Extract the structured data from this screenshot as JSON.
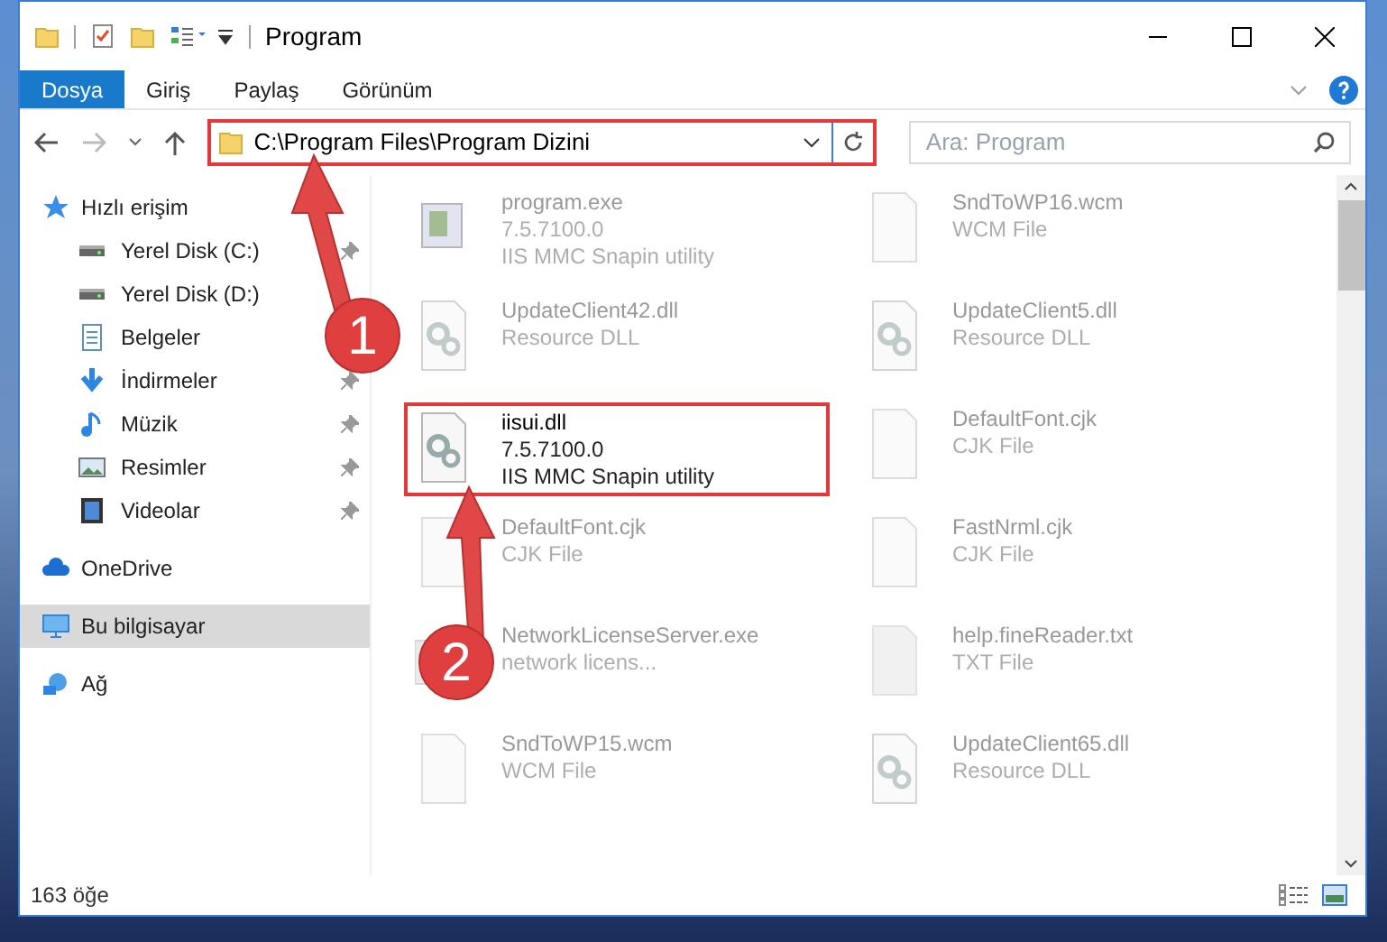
{
  "window": {
    "title": "Program"
  },
  "ribbon_tabs": [
    {
      "label": "Dosya",
      "selected": true
    },
    {
      "label": "Giriş",
      "selected": false
    },
    {
      "label": "Paylaş",
      "selected": false
    },
    {
      "label": "Görünüm",
      "selected": false
    }
  ],
  "address_bar": {
    "path": "C:\\Program Files\\Program Dizini"
  },
  "search": {
    "placeholder": "Ara: Program"
  },
  "nav_pane": [
    {
      "label": "Hızlı erişim",
      "kind": "star",
      "selected": false,
      "children": [
        {
          "label": "Yerel Disk (C:)",
          "kind": "disk",
          "pinned": true
        },
        {
          "label": "Yerel Disk (D:)",
          "kind": "disk"
        },
        {
          "label": "Belgeler",
          "kind": "doc"
        },
        {
          "label": "İndirmeler",
          "kind": "download",
          "pinned": true
        },
        {
          "label": "Müzik",
          "kind": "music",
          "pinned": true
        },
        {
          "label": "Resimler",
          "kind": "picture",
          "pinned": true
        },
        {
          "label": "Videolar",
          "kind": "video",
          "pinned": true
        }
      ]
    },
    {
      "label": "OneDrive",
      "kind": "cloud",
      "selected": false
    },
    {
      "label": "Bu bilgisayar",
      "kind": "computer",
      "selected": true
    },
    {
      "label": "Ağ",
      "kind": "network",
      "selected": false
    }
  ],
  "files": [
    {
      "name": "program.exe",
      "lines": [
        "7.5.7100.0",
        "IIS MMC Snapin utility"
      ],
      "kind": "exe",
      "highlighted": false
    },
    {
      "name": "SndToWP16.wcm",
      "lines": [
        "WCM File"
      ],
      "kind": "blank",
      "highlighted": false
    },
    {
      "name": "UpdateClient42.dll",
      "lines": [
        "Resource DLL"
      ],
      "kind": "dll",
      "highlighted": false
    },
    {
      "name": "UpdateClient5.dll",
      "lines": [
        "Resource DLL"
      ],
      "kind": "dll",
      "highlighted": false
    },
    {
      "name": "iisui.dll",
      "lines": [
        "7.5.7100.0",
        "IIS MMC Snapin utility"
      ],
      "kind": "dll",
      "highlighted": true
    },
    {
      "name": "DefaultFont.cjk",
      "lines": [
        "CJK File"
      ],
      "kind": "blank",
      "highlighted": false
    },
    {
      "name": "DefaultFont.cjk",
      "lines": [
        "CJK File"
      ],
      "kind": "blank",
      "highlighted": false
    },
    {
      "name": "FastNrml.cjk",
      "lines": [
        "CJK File"
      ],
      "kind": "blank",
      "highlighted": false
    },
    {
      "name": "NetworkLicenseServer.exe",
      "lines": [
        "network licens..."
      ],
      "kind": "app",
      "highlighted": false
    },
    {
      "name": "help.fineReader.txt",
      "lines": [
        "TXT File"
      ],
      "kind": "txt",
      "highlighted": false
    },
    {
      "name": "SndToWP15.wcm",
      "lines": [
        "WCM File"
      ],
      "kind": "blank",
      "highlighted": false
    },
    {
      "name": "UpdateClient65.dll",
      "lines": [
        "Resource DLL"
      ],
      "kind": "dll",
      "highlighted": false
    }
  ],
  "annotations": [
    {
      "label": "1"
    },
    {
      "label": "2"
    }
  ],
  "status_bar": {
    "count": "163 öğe"
  }
}
